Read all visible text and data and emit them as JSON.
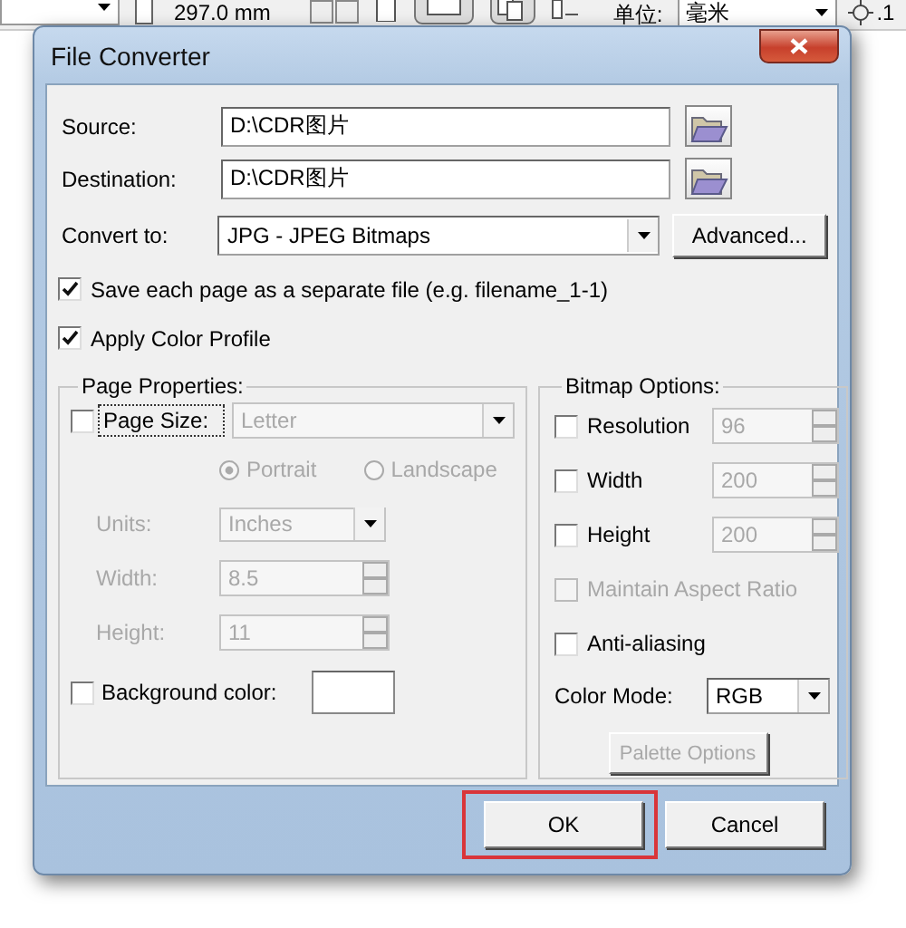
{
  "toolbar": {
    "page_height": "297.0 mm",
    "units_label": "单位:",
    "units_value": "毫米",
    "nudge_value": ".1"
  },
  "dialog": {
    "title": "File Converter",
    "source": {
      "label": "Source:",
      "value": "D:\\CDR图片"
    },
    "destination": {
      "label": "Destination:",
      "value": "D:\\CDR图片"
    },
    "convert_to": {
      "label": "Convert to:",
      "value": "JPG - JPEG Bitmaps"
    },
    "advanced_button": "Advanced...",
    "options": [
      {
        "label": "Save each page as a separate file (e.g. filename_1-1)",
        "checked": true
      },
      {
        "label": "Apply Color Profile",
        "checked": true
      }
    ],
    "page_properties": {
      "title": "Page Properties:",
      "page_size": {
        "label": "Page Size:",
        "checked": false,
        "focused": true,
        "value": "Letter",
        "disabled": true
      },
      "orientation": [
        {
          "label": "Portrait",
          "selected": true,
          "disabled": true
        },
        {
          "label": "Landscape",
          "selected": false,
          "disabled": true
        }
      ],
      "fields": [
        {
          "kind": "select",
          "label": "Units:",
          "value": "Inches",
          "disabled": true
        },
        {
          "kind": "spin",
          "label": "Width:",
          "value": "8.5",
          "disabled": true
        },
        {
          "kind": "spin",
          "label": "Height:",
          "value": "11",
          "disabled": true
        }
      ],
      "background_color": {
        "label": "Background color:",
        "checked": false,
        "color": "#ffffff"
      }
    },
    "bitmap_options": {
      "title": "Bitmap Options:",
      "rows": [
        {
          "kind": "spin",
          "label": "Resolution",
          "checked": false,
          "value": "96",
          "disabled": true
        },
        {
          "kind": "spin",
          "label": "Width",
          "checked": false,
          "value": "200",
          "disabled": true
        },
        {
          "kind": "spin",
          "label": "Height",
          "checked": false,
          "value": "200",
          "disabled": true
        },
        {
          "kind": "check",
          "label": "Maintain Aspect Ratio",
          "checked": false,
          "disabled": true
        },
        {
          "kind": "check",
          "label": "Anti-aliasing",
          "checked": false,
          "disabled": false
        },
        {
          "kind": "select",
          "label": "Color Mode:",
          "value": "RGB",
          "disabled": false
        },
        {
          "kind": "button",
          "label": "Palette Options",
          "disabled": true
        }
      ]
    },
    "buttons": [
      {
        "label": "OK",
        "highlighted": true
      },
      {
        "label": "Cancel",
        "highlighted": false
      }
    ]
  }
}
